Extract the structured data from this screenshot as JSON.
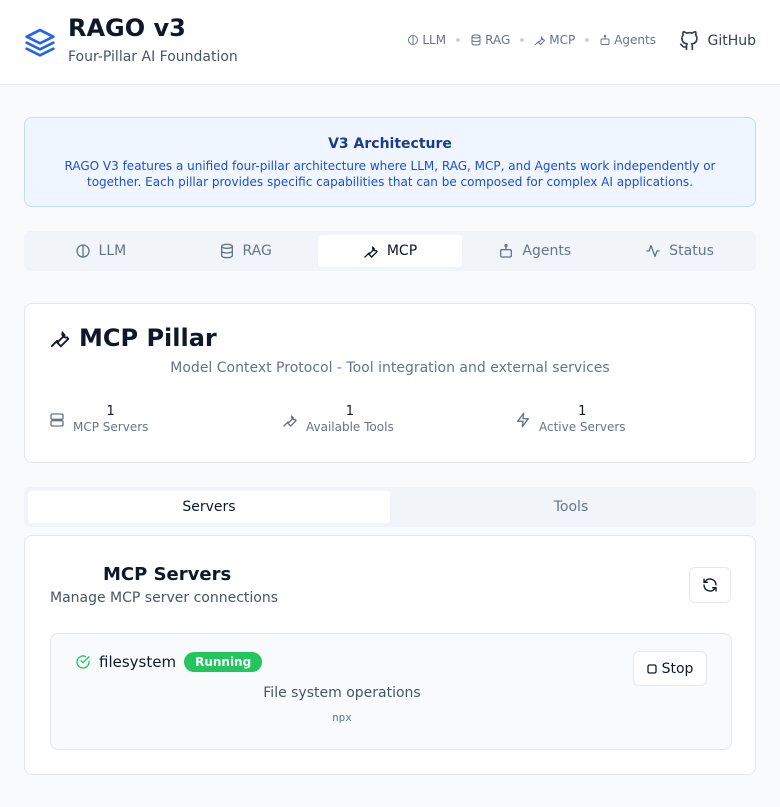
{
  "app": {
    "title": "RAGO v3",
    "subtitle": "Four-Pillar AI Foundation"
  },
  "topnav": {
    "items": [
      "LLM",
      "RAG",
      "MCP",
      "Agents"
    ],
    "github_label": "GitHub"
  },
  "banner": {
    "title": "V3 Architecture",
    "text": "RAGO V3 features a unified four-pillar architecture where LLM, RAG, MCP, and Agents work independently or together. Each pillar provides specific capabilities that can be composed for complex AI applications."
  },
  "pillar_tabs": {
    "items": [
      {
        "label": "LLM",
        "icon": "brain-icon"
      },
      {
        "label": "RAG",
        "icon": "database-icon"
      },
      {
        "label": "MCP",
        "icon": "wrench-icon"
      },
      {
        "label": "Agents",
        "icon": "bot-icon"
      },
      {
        "label": "Status",
        "icon": "activity-icon"
      }
    ],
    "active": "MCP"
  },
  "mcp": {
    "title": "MCP Pillar",
    "description": "Model Context Protocol - Tool integration and external services",
    "stats": [
      {
        "value": "1",
        "label": "MCP Servers",
        "icon": "server-icon"
      },
      {
        "value": "1",
        "label": "Available Tools",
        "icon": "wrench-icon"
      },
      {
        "value": "1",
        "label": "Active Servers",
        "icon": "zap-icon"
      }
    ]
  },
  "sub_tabs": {
    "items": [
      "Servers",
      "Tools"
    ],
    "active": "Servers"
  },
  "servers": {
    "title": "MCP Servers",
    "description": "Manage MCP server connections",
    "list": [
      {
        "name": "filesystem",
        "status": "Running",
        "description": "File system operations",
        "command": "npx",
        "action_label": "Stop"
      }
    ]
  },
  "colors": {
    "accent": "#2563eb",
    "running": "#22c55e",
    "banner_bg": "#eff6ff"
  }
}
